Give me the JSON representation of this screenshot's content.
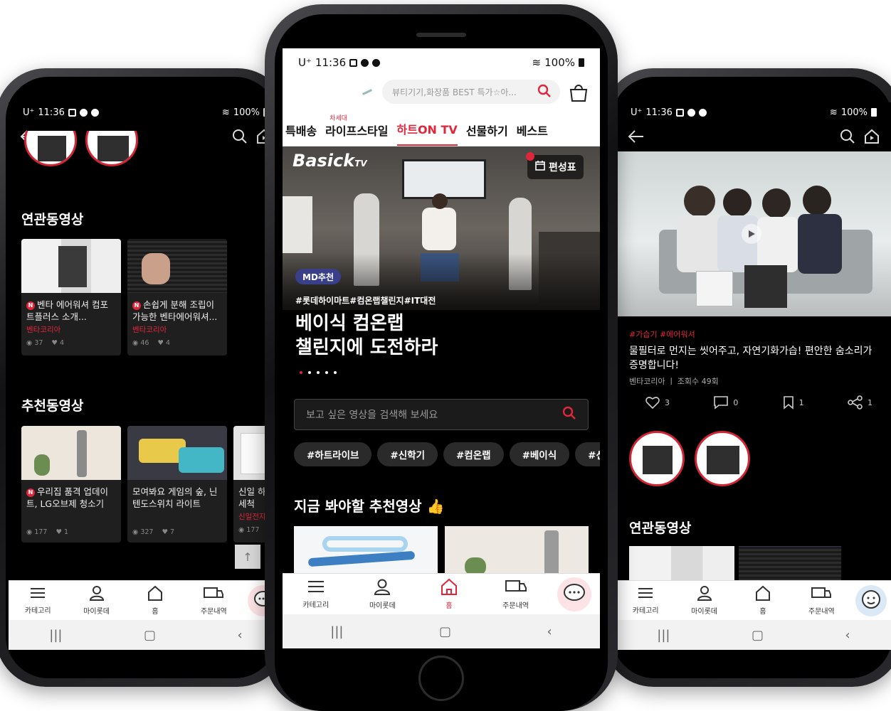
{
  "left": {
    "status": {
      "time": "11:36",
      "carrier": "U⁺",
      "battery": "100%"
    },
    "section_related": "연관동영상",
    "section_recommended": "추천동영상",
    "related_cards": [
      {
        "title": "벤타 에어워셔 컴포트플러스 소개...",
        "brand": "벤타코리아",
        "views": "37",
        "likes": "4"
      },
      {
        "title": "손쉽게 분해 조립이 가능한 벤타에어워셔...",
        "brand": "벤타코리아",
        "views": "46",
        "likes": "4"
      }
    ],
    "rec_cards": [
      {
        "title": "우리집 품격 업데이트, LG오브제 청소기",
        "brand": "",
        "views": "177",
        "likes": "1"
      },
      {
        "title": "모여봐요 게임의 숲, 닌텐도스위치 라이트",
        "brand": "",
        "views": "327",
        "likes": "7"
      },
      {
        "title": "신일 하이기 세척",
        "brand": "신일전자",
        "views": "177",
        "likes": ""
      }
    ],
    "tabs": [
      "카테고리",
      "마이롯데",
      "홈",
      "주문내역"
    ]
  },
  "center": {
    "status": {
      "time": "11:36",
      "carrier": "U⁺",
      "battery": "100%"
    },
    "search_placeholder": "뷰티기기,화장품 BEST 특가☆아...",
    "tabs": [
      "특배송",
      "라이프스타일",
      "하트ON TV",
      "선물하기",
      "베스트"
    ],
    "tab_superscript": "차세대",
    "hero": {
      "logo": "Basick",
      "logo_tv": "TV",
      "schedule": "편성표",
      "badge": "MD추천",
      "tags": "#롯데하이마트#컴온랩챌린지#IT대전",
      "title_line1": "베이식 컴온랩",
      "title_line2": "챌린지에 도전하라"
    },
    "video_search_placeholder": "보고 싶은 영상을 검색해 보세요",
    "chips": [
      "#하트라이브",
      "#신학기",
      "#컴온랩",
      "#베이식",
      "#신"
    ],
    "rec_title": "지금 봐야할 추천영상 👍",
    "tabbar": [
      "카테고리",
      "마이롯데",
      "홈",
      "주문내역"
    ],
    "colors": {
      "accent": "#e0263b"
    }
  },
  "right": {
    "status": {
      "time": "11:36",
      "carrier": "U⁺",
      "battery": "100%"
    },
    "tags": "#가습기 #에어워셔",
    "title": "물필터로 먼지는 씻어주고, 자연기화가습! 편안한 숨소리가 증명합니다!",
    "meta": "벤타코리아 ㅣ 조회수 49회",
    "actions": {
      "likes": "3",
      "comments": "0",
      "bookmarks": "1",
      "shares": "1"
    },
    "section_related": "연관동영상",
    "tabs": [
      "카테고리",
      "마이롯데",
      "홈",
      "주문내역"
    ]
  }
}
